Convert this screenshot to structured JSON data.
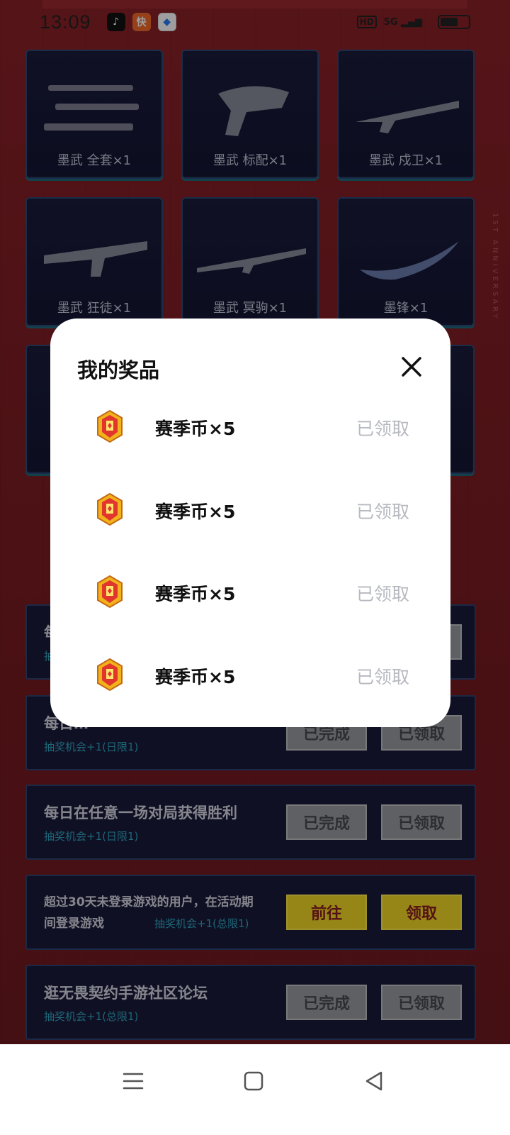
{
  "status_bar": {
    "time": "13:09",
    "app_icons": [
      {
        "name": "tiktok-icon",
        "glyph": "♪"
      },
      {
        "name": "kuaishou-icon",
        "glyph": "快"
      },
      {
        "name": "browser-icon",
        "glyph": "◆"
      }
    ],
    "hd": "HD",
    "network": "5G"
  },
  "prizes": [
    {
      "label": "墨武 全套×1"
    },
    {
      "label": "墨武 标配×1"
    },
    {
      "label": "墨武 戍卫×1"
    },
    {
      "label": "墨武 狂徒×1"
    },
    {
      "label": "墨武 冥驹×1"
    },
    {
      "label": "墨锋×1"
    }
  ],
  "side_text": "1ST ANNIVERSARY",
  "tasks": [
    {
      "title": "每日…",
      "subtitle": "抽奖机会+1(日限1)",
      "button1": "已完成",
      "button2": "已领取"
    },
    {
      "title": "每日在任意一场对局获得胜利",
      "subtitle": "抽奖机会+1(日限1)",
      "button1": "已完成",
      "button2": "已领取"
    },
    {
      "title": "超过30天未登录游戏的用户，在活动期间登录游戏",
      "subtitle": "抽奖机会+1(总限1)",
      "button1": "前往",
      "button2": "领取"
    },
    {
      "title": "逛无畏契约手游社区论坛",
      "subtitle": "抽奖机会+1(总限1)",
      "button1": "已完成",
      "button2": "已领取"
    }
  ],
  "dialog": {
    "title": "我的奖品",
    "items": [
      {
        "name": "赛季币×5",
        "status": "已领取"
      },
      {
        "name": "赛季币×5",
        "status": "已领取"
      },
      {
        "name": "赛季币×5",
        "status": "已领取"
      },
      {
        "name": "赛季币×5",
        "status": "已领取"
      }
    ]
  },
  "colors": {
    "background": "#7a1f25",
    "card": "#1a1b3a",
    "accent_yellow": "#f0d826",
    "claimed_gray": "#b7b9c0"
  }
}
